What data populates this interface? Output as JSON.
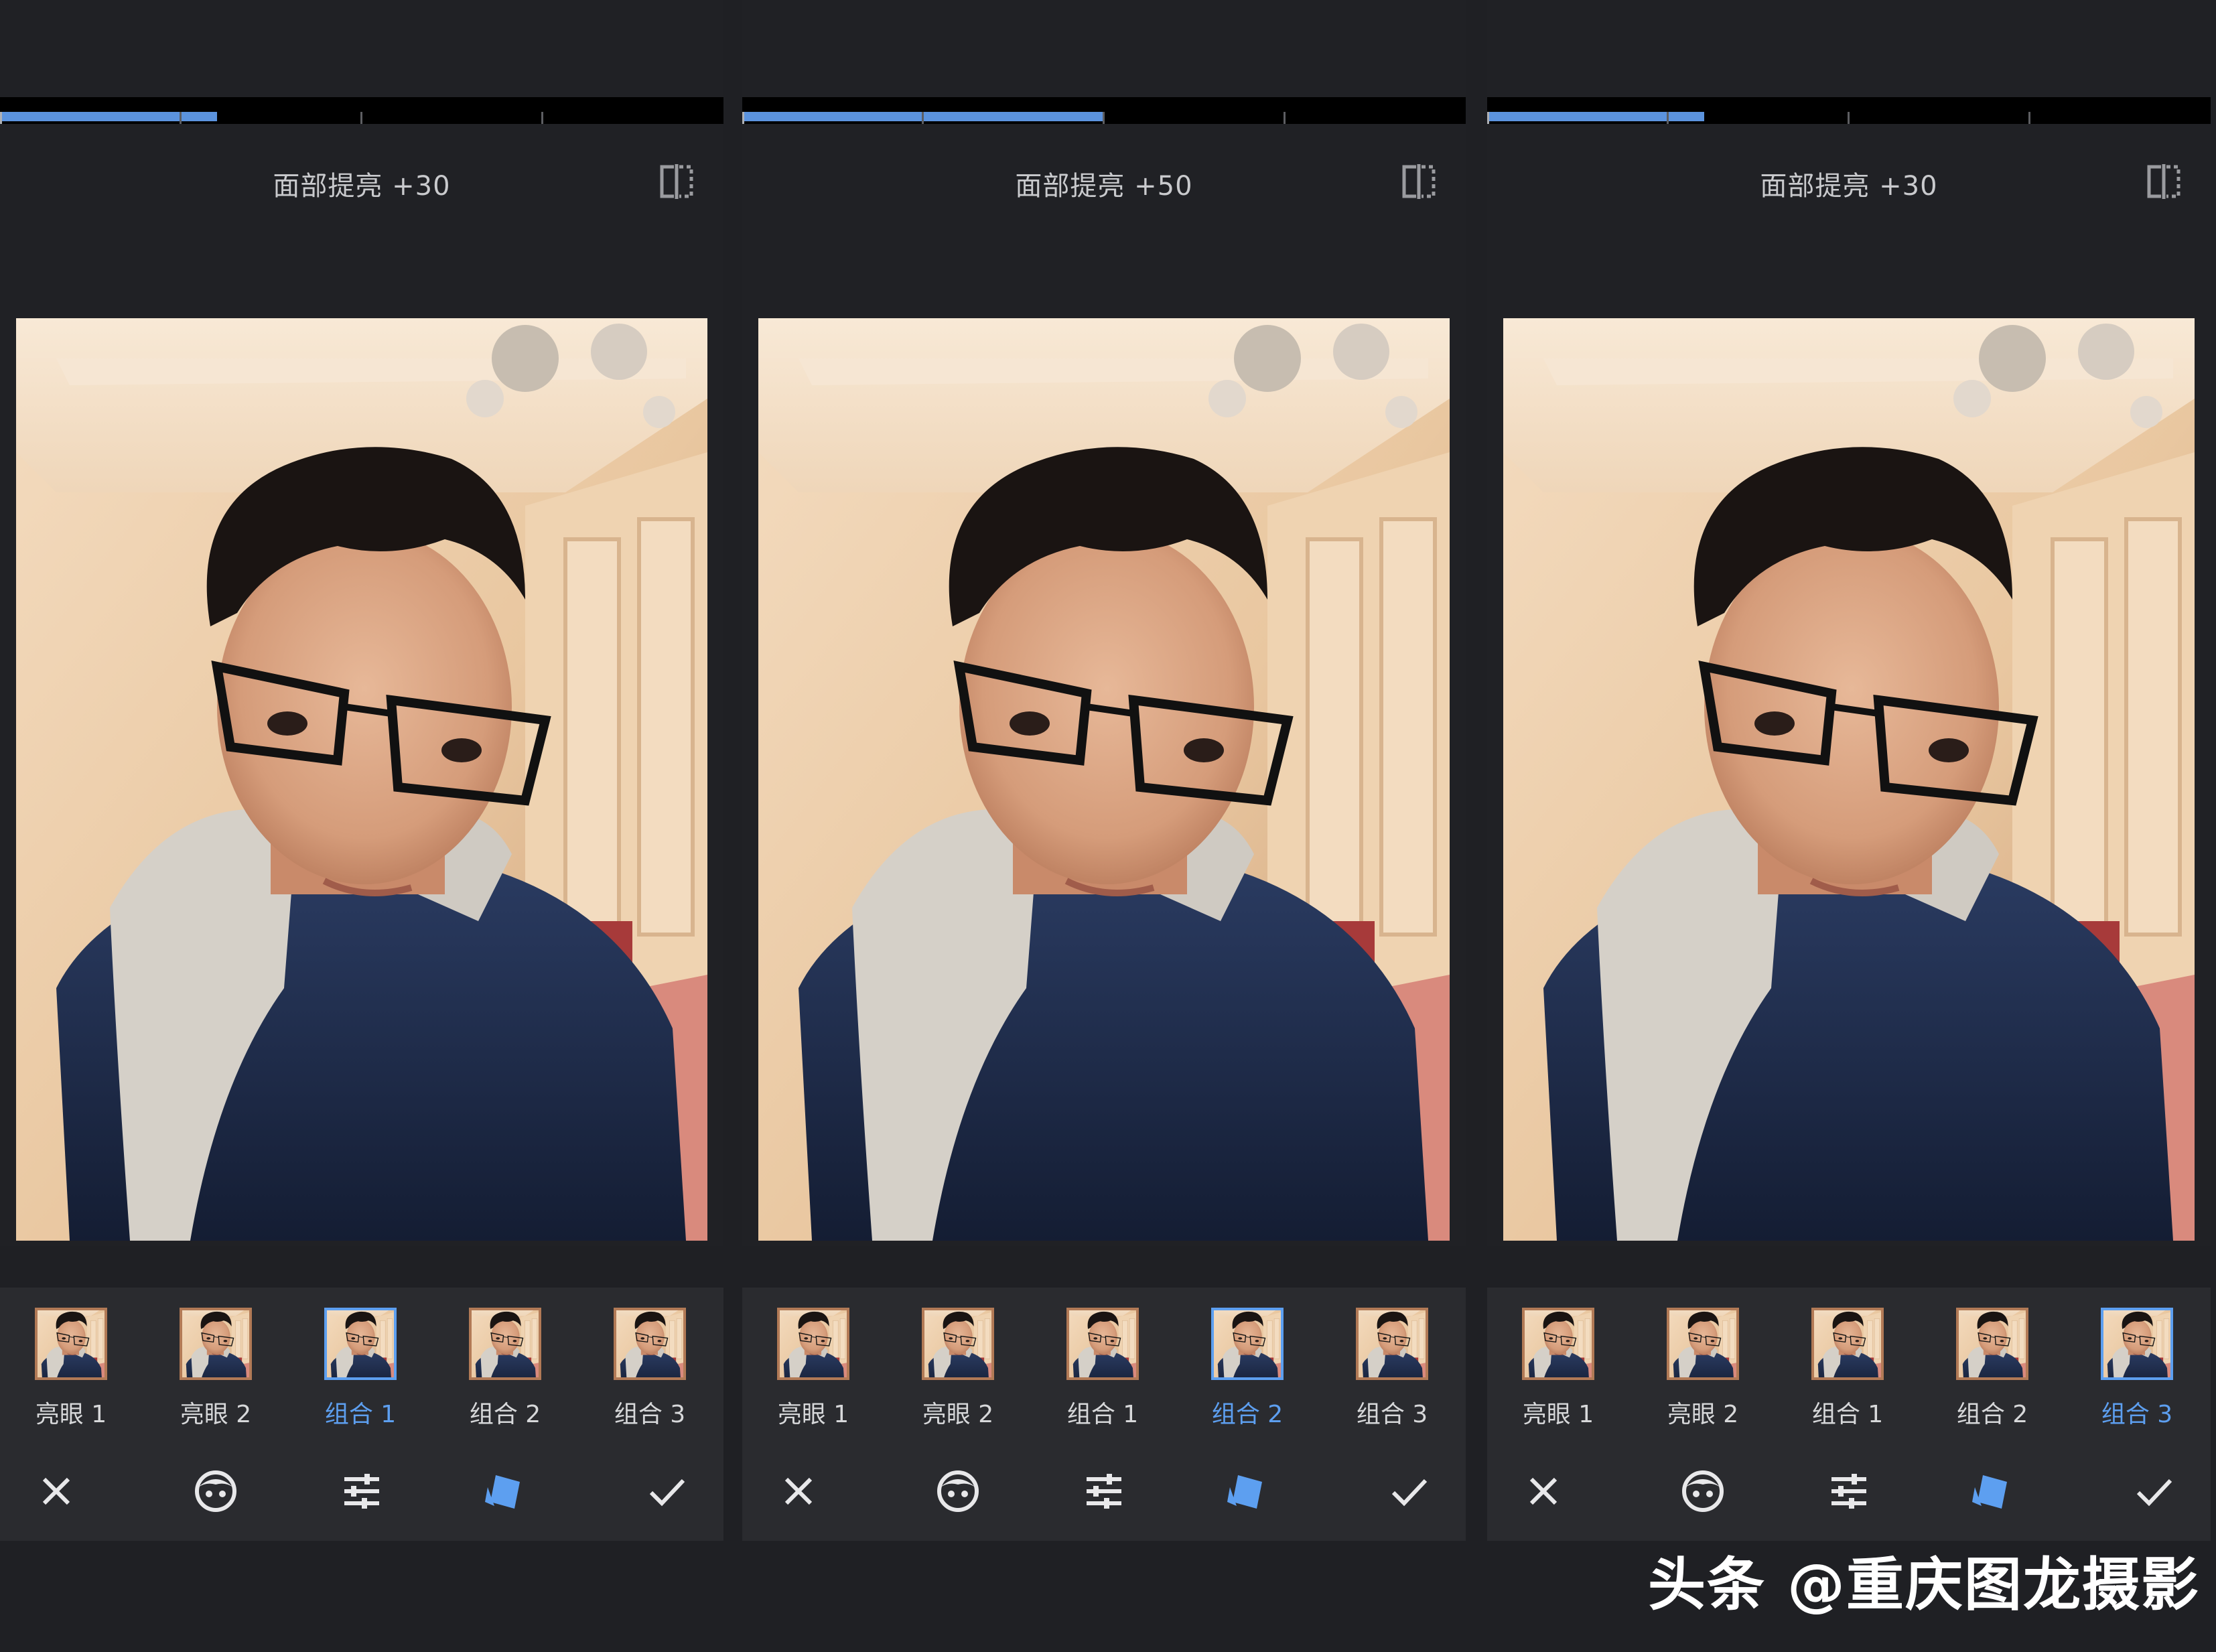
{
  "panels": [
    {
      "adjust_label": "面部提亮 +30",
      "slider_value_pct": 30,
      "selected_preset": 2
    },
    {
      "adjust_label": "面部提亮 +50",
      "slider_value_pct": 50,
      "selected_preset": 3
    },
    {
      "adjust_label": "面部提亮 +30",
      "slider_value_pct": 30,
      "selected_preset": 4
    }
  ],
  "presets": [
    "亮眼 1",
    "亮眼 2",
    "组合 1",
    "组合 2",
    "组合 3"
  ],
  "toolbar_icons": [
    "close-icon",
    "face-icon",
    "tune-icon",
    "styles-icon",
    "check-icon"
  ],
  "icons": {
    "compare": "compare-icon"
  },
  "colors": {
    "accent": "#5d9ff0",
    "background": "#1f2024",
    "bar": "#2a2b2f"
  },
  "watermark": "头条 @重庆图龙摄影"
}
